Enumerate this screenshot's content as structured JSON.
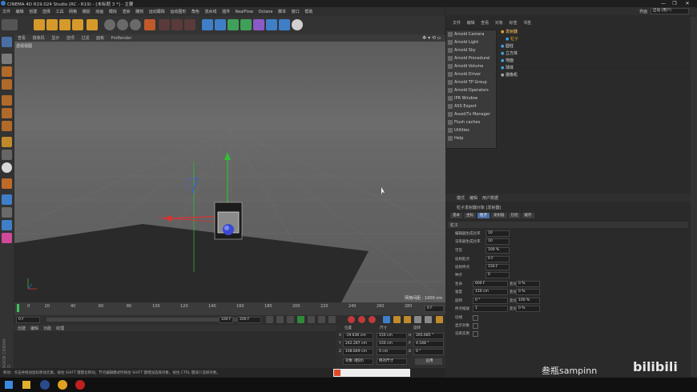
{
  "window": {
    "title": "CINEMA 4D R19.024 Studio (RC - R19) - [未标题 3 *] - 主要",
    "controls": [
      "—",
      "❐",
      "✕"
    ]
  },
  "menubar": [
    "文件",
    "编辑",
    "创建",
    "选择",
    "工具",
    "网格",
    "捕捉",
    "动画",
    "模拟",
    "渲染",
    "雕刻",
    "运动跟踪",
    "运动图形",
    "角色",
    "流水线",
    "插件",
    "RealFlow",
    "Octane",
    "脚本",
    "窗口",
    "帮助"
  ],
  "layout": {
    "label": "界面",
    "value": "启动 (用户)"
  },
  "viewport": {
    "menu": [
      "查看",
      "摄像机",
      "显示",
      "选项",
      "过滤",
      "面板",
      "ProRender"
    ],
    "camera_label": "透视视图",
    "grid_info": "网格间距 : 1000 cm"
  },
  "timeline": {
    "ticks": [
      "0",
      "20",
      "40",
      "60",
      "80",
      "100",
      "120",
      "140",
      "160",
      "180",
      "200",
      "220",
      "240",
      "260",
      "280"
    ],
    "current_frame": "0 F",
    "start": "0 F",
    "end": "100 F",
    "max": "200 F"
  },
  "material_panel": {
    "menu": [
      "创建",
      "编辑",
      "功能",
      "纹理"
    ]
  },
  "coords": {
    "headers": [
      "位置",
      "尺寸",
      "旋转"
    ],
    "rows": [
      {
        "axis": "X",
        "pos": "-19.636 cm",
        "size": "150 cm",
        "rot_axis": "H",
        "rot": "265.685 °"
      },
      {
        "axis": "Y",
        "pos": "242.287 cm",
        "size": "150 cm",
        "rot_axis": "P",
        "rot": "4.548 °"
      },
      {
        "axis": "Z",
        "pos": "108.849 cm",
        "size": "0 cm",
        "rot_axis": "B",
        "rot": "0 °"
      }
    ],
    "mode": "对象 (相对)",
    "size_mode": "绝对尺寸",
    "apply": "应用"
  },
  "status": "移动：点击并拖动鼠标移动元素。按住 SHIFT 键量化移动，节点编辑模式时按住 SHIFT 键增加选择对象，按住 CTRL 键减少选择对象。",
  "right_panel": {
    "tabs": [
      "文件",
      "编辑",
      "查看",
      "对象",
      "标签",
      "书签"
    ],
    "arnold_menu": [
      "Arnold Camera",
      "Arnold Light",
      "Arnold Sky",
      "Arnold Procedural",
      "Arnold Volume",
      "Arnold Driver",
      "Arnold TP Group",
      "Arnold Operators",
      "IPR Window",
      "ASS Export",
      "Asset/Tx Manager",
      "Flush caches",
      "Utilities",
      "Help"
    ],
    "objects": [
      "发射器",
      "粒子",
      "圆柱",
      "立方体",
      "地面",
      "球体",
      "摄像机"
    ],
    "attr_tabs_top": [
      "模式",
      "编辑",
      "用户数据"
    ],
    "attr_title": "粒子发射器对象 [发射器]",
    "attr_tabs": [
      "基本",
      "坐标",
      "粒子",
      "发射器",
      "包括",
      "缓存"
    ],
    "active_attr_tab": "粒子",
    "section": "粒子",
    "params": [
      {
        "label": "编辑器生成比率",
        "value": "10"
      },
      {
        "label": "渲染器生成比率",
        "value": "10"
      },
      {
        "label": "可见",
        "value": "100 %"
      },
      {
        "label": "投射起点",
        "value": "0 F"
      },
      {
        "label": "投射终点",
        "value": "150 F"
      },
      {
        "label": "种子",
        "value": "0"
      },
      {
        "label": "生命",
        "value": "600 F",
        "v_label": "变化",
        "v": "0 %"
      },
      {
        "label": "速度",
        "value": "150 cm",
        "v_label": "变化",
        "v": "0 %"
      },
      {
        "label": "旋转",
        "value": "0 °",
        "v_label": "变化",
        "v": "100 %"
      },
      {
        "label": "终点缩放",
        "value": "1",
        "v_label": "变化",
        "v": "0 %"
      }
    ],
    "checks": [
      "切线",
      "显示对象",
      "渲染实例"
    ]
  },
  "watermark": {
    "uploader": "叁瓶sampinn",
    "logo": "bilibili"
  },
  "cinema_logo": "MAXON CINEMA 4D",
  "colors": {
    "x_axis": "#e03030",
    "y_axis": "#30c030",
    "z_axis": "#3060e0",
    "accent": "#4a6fa5"
  }
}
